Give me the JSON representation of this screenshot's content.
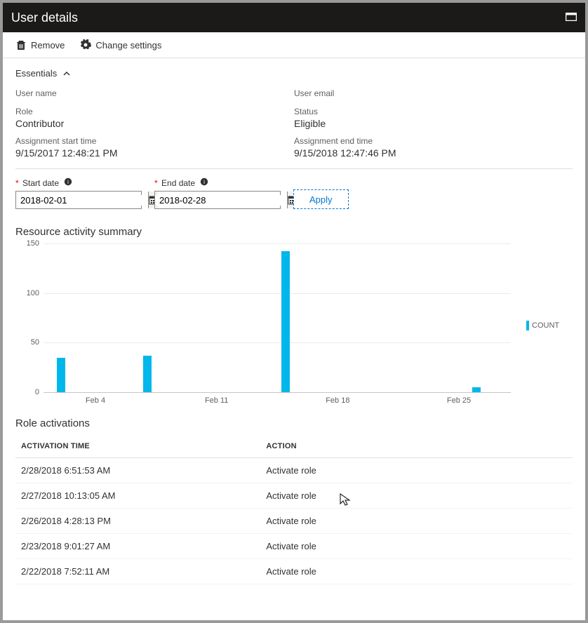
{
  "window": {
    "title": "User details"
  },
  "toolbar": {
    "remove": "Remove",
    "change_settings": "Change settings"
  },
  "essentials": {
    "header": "Essentials",
    "username_label": "User name",
    "username_value": "",
    "email_label": "User email",
    "email_value": "",
    "role_label": "Role",
    "role_value": "Contributor",
    "status_label": "Status",
    "status_value": "Eligible",
    "start_label": "Assignment start time",
    "start_value": "9/15/2017 12:48:21 PM",
    "end_label": "Assignment end time",
    "end_value": "9/15/2018 12:47:46 PM"
  },
  "dates": {
    "start_label": "Start date",
    "start_value": "2018-02-01",
    "end_label": "End date",
    "end_value": "2018-02-28",
    "apply": "Apply"
  },
  "chart_section_title": "Resource activity summary",
  "chart_data": {
    "type": "bar",
    "title": "Resource activity summary",
    "legend": [
      "COUNT"
    ],
    "ylabel": "",
    "xlabel": "",
    "ylim": [
      0,
      150
    ],
    "yticks": [
      0,
      50,
      100,
      150
    ],
    "xticks": [
      "Feb 4",
      "Feb 11",
      "Feb 18",
      "Feb 25"
    ],
    "series": [
      {
        "name": "COUNT",
        "color": "#00b7eb",
        "points": [
          {
            "x": "2018-02-02",
            "value": 35
          },
          {
            "x": "2018-02-07",
            "value": 37
          },
          {
            "x": "2018-02-15",
            "value": 142
          },
          {
            "x": "2018-02-26",
            "value": 5
          }
        ]
      }
    ]
  },
  "activations": {
    "title": "Role activations",
    "columns": {
      "time": "ACTIVATION TIME",
      "action": "ACTION"
    },
    "rows": [
      {
        "time": "2/28/2018 6:51:53 AM",
        "action": "Activate role"
      },
      {
        "time": "2/27/2018 10:13:05 AM",
        "action": "Activate role"
      },
      {
        "time": "2/26/2018 4:28:13 PM",
        "action": "Activate role"
      },
      {
        "time": "2/23/2018 9:01:27 AM",
        "action": "Activate role"
      },
      {
        "time": "2/22/2018 7:52:11 AM",
        "action": "Activate role"
      }
    ]
  }
}
